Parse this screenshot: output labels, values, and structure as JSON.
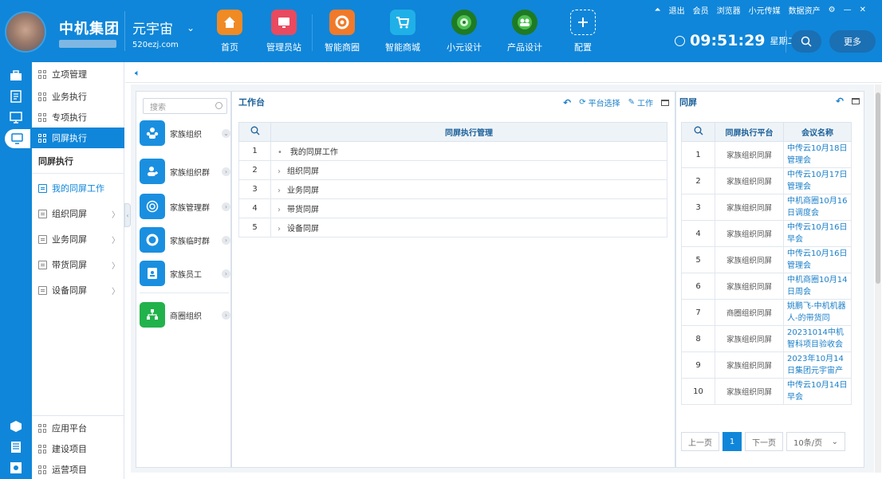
{
  "header": {
    "brand": "中机集团",
    "yuan": "元宇宙",
    "domain": "520ezj.com",
    "nav": [
      {
        "label": "首页",
        "icon": "home-icon",
        "color": "#f08a24"
      },
      {
        "label": "管理员站",
        "icon": "monitor-icon",
        "color": "#e84a5f"
      },
      {
        "label": "智能商圈",
        "icon": "circle-network-icon",
        "color": "#f07a2a"
      },
      {
        "label": "智能商城",
        "icon": "shopping-cart-icon",
        "color": "#20b0e8"
      },
      {
        "label": "小元设计",
        "icon": "globe-design-icon",
        "color": "#2c9a2e"
      },
      {
        "label": "产品设计",
        "icon": "people-globe-icon",
        "color": "#34a040"
      },
      {
        "label": "配置",
        "icon": "plus-icon",
        "color": "#0f86d9"
      }
    ],
    "top_links": [
      "退出",
      "会员",
      "浏览器",
      "小元传媒",
      "数据资产"
    ],
    "time": "09:51:29",
    "weekday": "星期二",
    "more": "更多"
  },
  "menu": {
    "top_items": [
      "立项管理",
      "业务执行",
      "专项执行",
      "同屏执行"
    ],
    "active_index": 3,
    "section_title": "同屏执行",
    "sub_items": [
      "我的同屏工作",
      "组织同屏",
      "业务同屏",
      "带货同屏",
      "设备同屏"
    ],
    "bottom_items": [
      "应用平台",
      "建设项目",
      "运营项目"
    ]
  },
  "groups": {
    "search_placeholder": "搜索",
    "items": [
      {
        "label": "家族组织",
        "color": "#1a8fe0"
      },
      {
        "label": "家族组织群",
        "color": "#1a8fe0"
      },
      {
        "label": "家族管理群",
        "color": "#1a8fe0"
      },
      {
        "label": "家族临时群",
        "color": "#1a8fe0"
      },
      {
        "label": "家族员工",
        "color": "#1a8fe0"
      },
      {
        "label": "商圈组织",
        "color": "#22b24c"
      }
    ]
  },
  "workspace": {
    "title": "工作台",
    "platform_select": "平台选择",
    "work": "工作",
    "col_header": "同屏执行管理",
    "rows": [
      {
        "no": "1",
        "label": "我的同屏工作"
      },
      {
        "no": "2",
        "label": "组织同屏"
      },
      {
        "no": "3",
        "label": "业务同屏"
      },
      {
        "no": "4",
        "label": "带货同屏"
      },
      {
        "no": "5",
        "label": "设备同屏"
      }
    ]
  },
  "screen": {
    "title": "同屏",
    "col_platform": "同屏执行平台",
    "col_meeting": "会议名称",
    "rows": [
      {
        "no": "1",
        "platform": "家族组织同屏",
        "meeting": "中传云10月18日管理会"
      },
      {
        "no": "2",
        "platform": "家族组织同屏",
        "meeting": "中传云10月17日管理会"
      },
      {
        "no": "3",
        "platform": "家族组织同屏",
        "meeting": "中机商圈10月16日调度会"
      },
      {
        "no": "4",
        "platform": "家族组织同屏",
        "meeting": "中传云10月16日早会"
      },
      {
        "no": "5",
        "platform": "家族组织同屏",
        "meeting": "中传云10月16日管理会"
      },
      {
        "no": "6",
        "platform": "家族组织同屏",
        "meeting": "中机商圈10月14日周会"
      },
      {
        "no": "7",
        "platform": "商圈组织同屏",
        "meeting": "姚鹏飞-中机机器人-的带货同"
      },
      {
        "no": "8",
        "platform": "家族组织同屏",
        "meeting": "20231014中机智科项目验收会"
      },
      {
        "no": "9",
        "platform": "家族组织同屏",
        "meeting": "2023年10月14日集团元宇宙产"
      },
      {
        "no": "10",
        "platform": "家族组织同屏",
        "meeting": "中传云10月14日早会"
      }
    ],
    "pager": {
      "prev": "上一页",
      "current": "1",
      "next": "下一页",
      "size": "10条/页"
    }
  }
}
